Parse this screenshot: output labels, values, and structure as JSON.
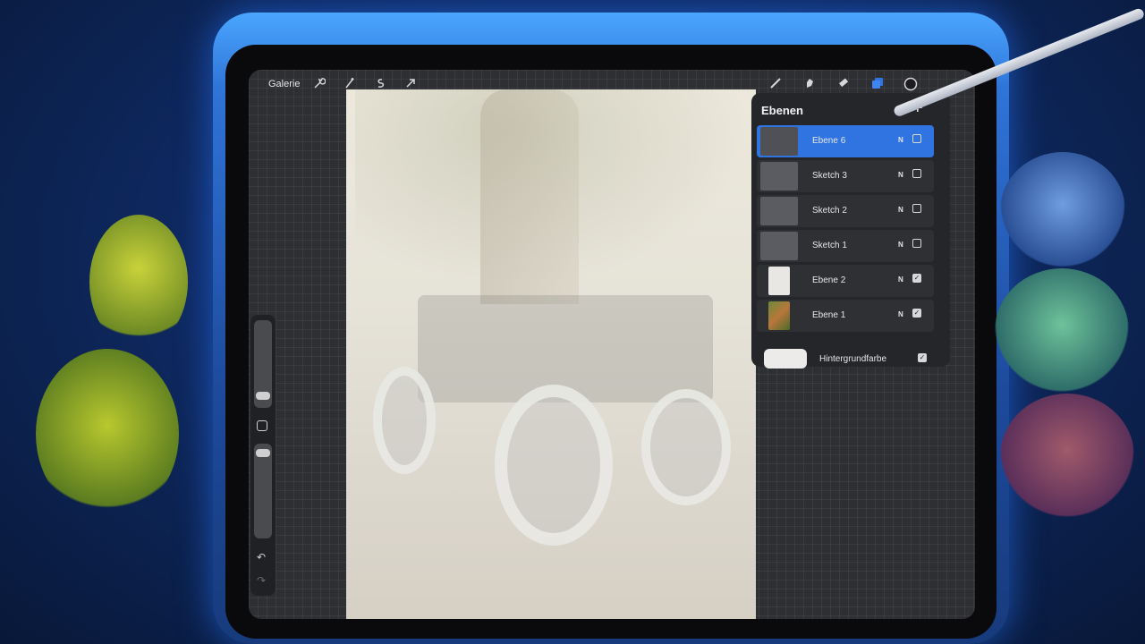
{
  "topbar": {
    "gallery_label": "Galerie",
    "left_tools": [
      "wrench-icon",
      "magic-wand-icon",
      "selection-icon",
      "transform-arrow-icon"
    ],
    "right_tools": [
      "brush-icon",
      "smudge-icon",
      "eraser-icon",
      "layers-icon",
      "color-picker-icon"
    ]
  },
  "layers_panel": {
    "title": "Ebenen",
    "add_label": "+",
    "layers": [
      {
        "name": "Ebene 6",
        "mode": "N",
        "visible": true,
        "active": true
      },
      {
        "name": "Sketch 3",
        "mode": "N",
        "visible": false,
        "active": false
      },
      {
        "name": "Sketch 2",
        "mode": "N",
        "visible": false,
        "active": false
      },
      {
        "name": "Sketch 1",
        "mode": "N",
        "visible": false,
        "active": false
      },
      {
        "name": "Ebene 2",
        "mode": "N",
        "visible": true,
        "active": false
      },
      {
        "name": "Ebene 1",
        "mode": "N",
        "visible": true,
        "active": false
      }
    ],
    "background": {
      "name": "Hintergrundfarbe",
      "visible": true,
      "color": "#ecebea"
    }
  },
  "sidebar": {
    "undo_label": "↶",
    "redo_label": "↷"
  },
  "colors": {
    "accent": "#2f74e0"
  }
}
